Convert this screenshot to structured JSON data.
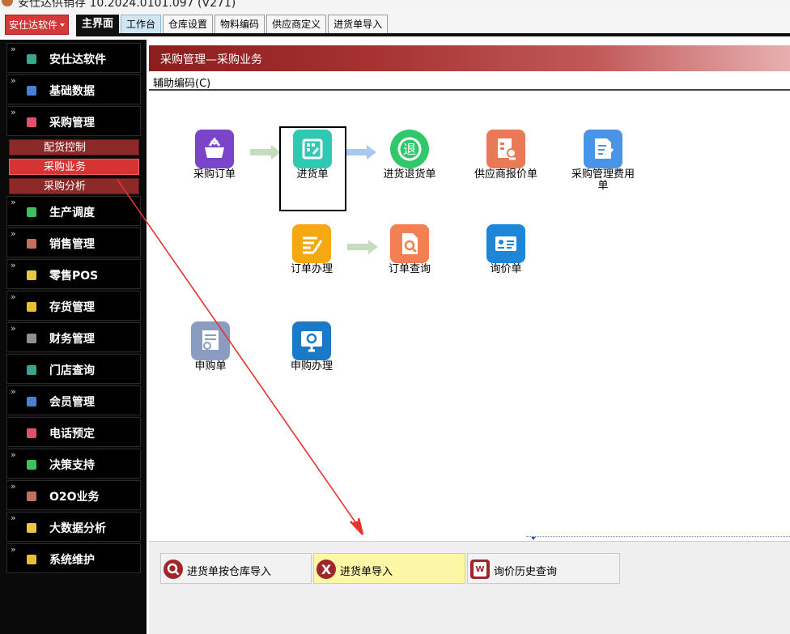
{
  "titlebar": {
    "text": "安仕达供销存 10.2024.0101.097 (V271)"
  },
  "toolbar": {
    "brand_label": "安仕达软件",
    "tabs": [
      "主界面",
      "工作台",
      "仓库设置",
      "物料编码",
      "供应商定义",
      "进货单导入"
    ]
  },
  "sidebar": {
    "items": [
      {
        "label": "安仕达软件",
        "icon": "module-icon",
        "color": "#3aa58a"
      },
      {
        "label": "基础数据",
        "icon": "module-icon",
        "color": "#4a7fd6"
      },
      {
        "label": "采购管理",
        "icon": "module-icon",
        "color": "#e0506a"
      },
      {
        "label": "生产调度",
        "icon": "module-icon",
        "color": "#3cc060"
      },
      {
        "label": "销售管理",
        "icon": "module-icon",
        "color": "#c07060"
      },
      {
        "label": "零售POS",
        "icon": "module-icon",
        "color": "#e8c840"
      },
      {
        "label": "存货管理",
        "icon": "module-icon",
        "color": "#e8c030"
      },
      {
        "label": "财务管理",
        "icon": "module-icon",
        "color": "#909090"
      },
      {
        "label": "门店查询",
        "icon": "module-icon",
        "color": "#3aa58a"
      },
      {
        "label": "会员管理",
        "icon": "module-icon",
        "color": "#4a7fd6"
      },
      {
        "label": "电话预定",
        "icon": "module-icon",
        "color": "#e0506a"
      },
      {
        "label": "决策支持",
        "icon": "module-icon",
        "color": "#3cc060"
      },
      {
        "label": "O2O业务",
        "icon": "module-icon",
        "color": "#c07060"
      },
      {
        "label": "大数据分析",
        "icon": "module-icon",
        "color": "#e8c840"
      },
      {
        "label": "系统维护",
        "icon": "module-icon",
        "color": "#e8c030"
      }
    ],
    "subitems": [
      "配货控制",
      "采购业务",
      "采购分析"
    ]
  },
  "header": {
    "title": "采购管理—采购业务"
  },
  "helper": {
    "label": "辅助编码(C)"
  },
  "flow": {
    "nodes": [
      {
        "label": "采购订单",
        "icon": "basket-icon",
        "color": "#7a45c8"
      },
      {
        "label": "进货单",
        "icon": "edit-grid-icon",
        "color": "#2ec9b0"
      },
      {
        "label": "进货退货单",
        "icon": "return-icon",
        "color": "#2fc86a"
      },
      {
        "label": "供应商报价单",
        "icon": "quote-doc-icon",
        "color": "#ea7a56"
      },
      {
        "label": "采购管理费用单",
        "icon": "edit-doc-icon",
        "color": "#4a94e8"
      },
      {
        "label": "订单办理",
        "icon": "list-pen-icon",
        "color": "#f6a812"
      },
      {
        "label": "订单查询",
        "icon": "search-doc-icon",
        "color": "#f28052"
      },
      {
        "label": "询价单",
        "icon": "id-card-icon",
        "color": "#1e86d8"
      },
      {
        "label": "申购单",
        "icon": "form-check-icon",
        "color": "#8a9cc0"
      },
      {
        "label": "申购办理",
        "icon": "monitor-gear-icon",
        "color": "#1a7ac8"
      }
    ]
  },
  "quick": [
    {
      "label": "进货单按仓库导入",
      "icon": "search-circle-icon",
      "color": "#a0262a"
    },
    {
      "label": "进货单导入",
      "icon": "excel-x-icon",
      "color": "#a0262a"
    },
    {
      "label": "询价历史查询",
      "icon": "word-w-icon",
      "color": "#a0262a"
    }
  ],
  "colors": {
    "accent": "#8d1d1d",
    "active_sub": "#d63434",
    "annotation_arrow": "#e8332a"
  }
}
